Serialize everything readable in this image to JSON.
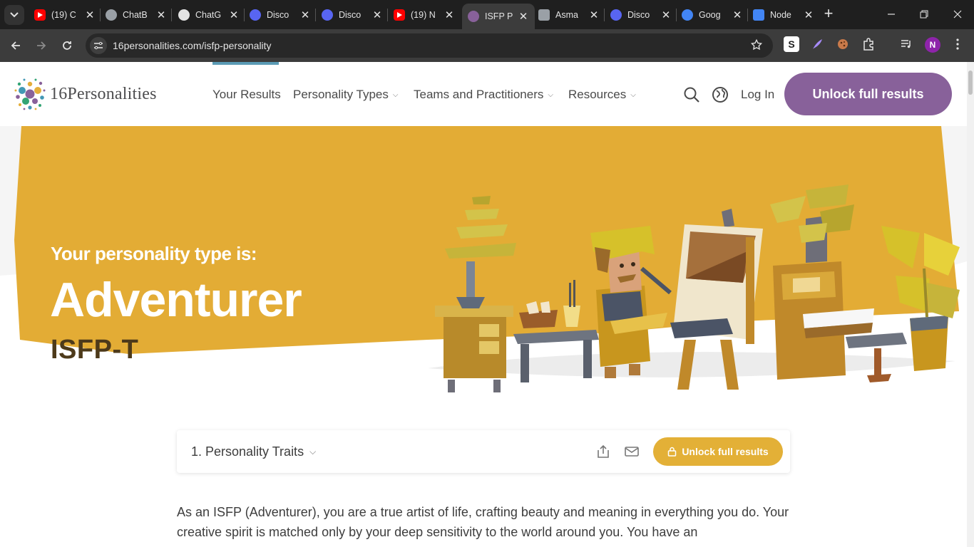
{
  "browser": {
    "tabs": [
      {
        "title": "(19) C",
        "icon": "youtube-icon",
        "color": "#ff0000"
      },
      {
        "title": "ChatB",
        "icon": "globe-icon",
        "color": "#9aa0a6"
      },
      {
        "title": "ChatG",
        "icon": "openai-icon",
        "color": "#e3e3e3"
      },
      {
        "title": "Disco",
        "icon": "discord-icon",
        "color": "#5865f2"
      },
      {
        "title": "Disco",
        "icon": "discord-icon",
        "color": "#5865f2"
      },
      {
        "title": "(19) N",
        "icon": "youtube-icon",
        "color": "#ff0000"
      },
      {
        "title": "ISFP P",
        "icon": "16p-icon",
        "color": "#88619a",
        "active": true
      },
      {
        "title": "Asma",
        "icon": "bird-icon",
        "color": "#9aa0a6"
      },
      {
        "title": "Disco",
        "icon": "discord-icon",
        "color": "#5865f2"
      },
      {
        "title": "Goog",
        "icon": "google-icon",
        "color": "#4285f4"
      },
      {
        "title": "Node",
        "icon": "docs-icon",
        "color": "#4285f4"
      }
    ],
    "url": "16personalities.com/isfp-personality",
    "profile_initial": "N"
  },
  "site": {
    "logo_text": "16Personalities",
    "nav": [
      {
        "label": "Your Results",
        "dropdown": false
      },
      {
        "label": "Personality Types",
        "dropdown": true
      },
      {
        "label": "Teams and Practitioners",
        "dropdown": true
      },
      {
        "label": "Resources",
        "dropdown": true
      }
    ],
    "login_label": "Log In",
    "unlock_label": "Unlock full results",
    "brand_color": "#88619a",
    "accent_color": "#e3b037"
  },
  "hero": {
    "subtitle": "Your personality type is:",
    "title": "Adventurer",
    "code": "ISFP-T",
    "bg_color": "#e3ac35"
  },
  "section": {
    "title": "1. Personality Traits",
    "unlock_label": "Unlock full results"
  },
  "intro": {
    "text": "As an ISFP (Adventurer), you are a true artist of life, crafting beauty and meaning in everything you do. Your creative spirit is matched only by your deep sensitivity to the world around you. You have an"
  }
}
